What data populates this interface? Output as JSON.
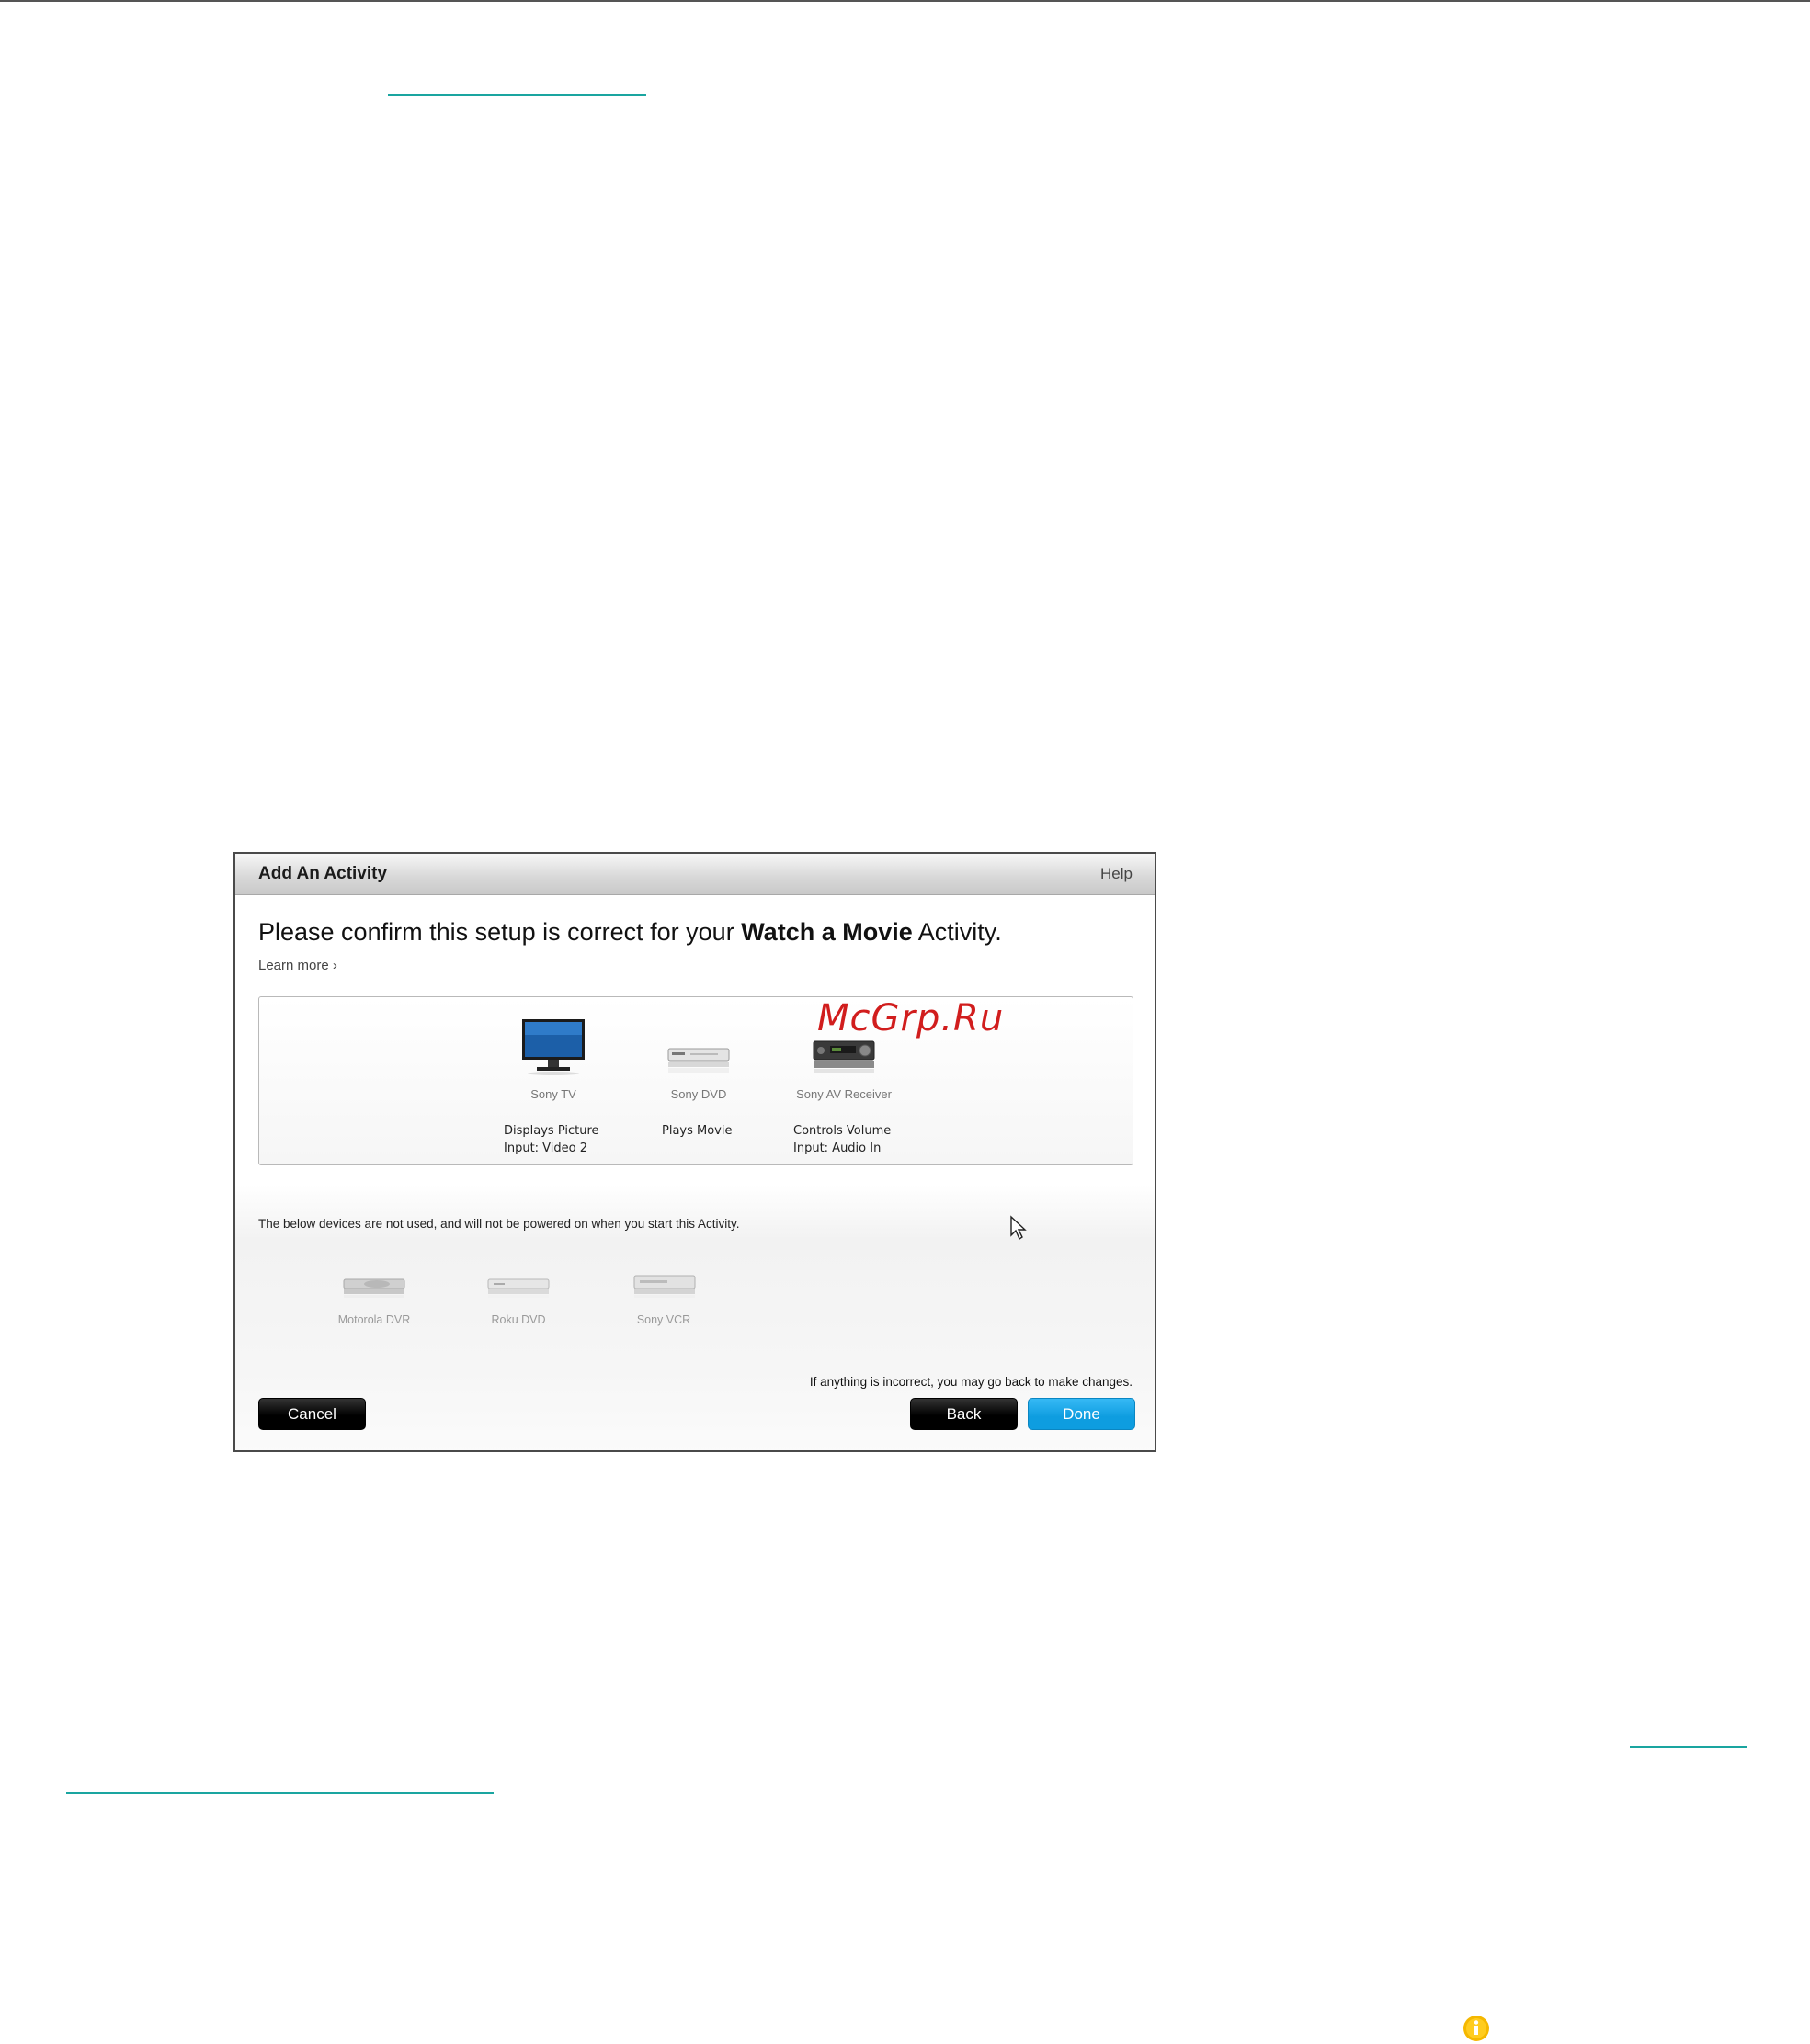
{
  "dialog": {
    "title": "Add An Activity",
    "help": "Help",
    "headline_prefix": "Please confirm this setup is correct for your ",
    "headline_activity": "Watch a Movie",
    "headline_suffix": " Activity.",
    "learn_more": "Learn more ›",
    "watermark": "McGrp.Ru",
    "used_devices": [
      {
        "name": "Sony TV",
        "role": "Displays Picture",
        "input": "Input: Video 2"
      },
      {
        "name": "Sony DVD",
        "role": "Plays Movie",
        "input": ""
      },
      {
        "name": "Sony AV Receiver",
        "role": "Controls Volume",
        "input": "Input: Audio In"
      }
    ],
    "unused_note": "The below devices are not used, and will not be powered on when you start this Activity.",
    "unused_devices": [
      {
        "name": "Motorola DVR"
      },
      {
        "name": "Roku DVD"
      },
      {
        "name": "Sony VCR"
      }
    ],
    "incorrect_note": "If anything is incorrect, you may go back to make changes.",
    "buttons": {
      "cancel": "Cancel",
      "back": "Back",
      "done": "Done"
    }
  },
  "colors": {
    "link": "#1aa5a0",
    "done_button": "#0e9de0",
    "watermark": "#d11d1d",
    "info": "#f5b800"
  },
  "icons": {
    "info": "info-icon",
    "cursor": "mouse-pointer-icon"
  }
}
